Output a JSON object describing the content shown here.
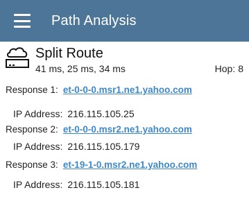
{
  "appbar": {
    "title": "Path Analysis",
    "color": "#4d7597"
  },
  "route": {
    "icon": "cloud-router-icon",
    "title": "Split Route",
    "times": "41 ms,  25 ms,  34 ms",
    "hop_label": "Hop:",
    "hop_value": "8"
  },
  "responses": [
    {
      "label": "Response 1:",
      "host": "et-0-0-0.msr1.ne1.yahoo.com",
      "ip_label": "IP Address:",
      "ip": "216.115.105.25"
    },
    {
      "label": "Response 2:",
      "host": "et-0-0-0.msr2.ne1.yahoo.com",
      "ip_label": "IP Address:",
      "ip": "216.115.105.179"
    },
    {
      "label": "Response 3:",
      "host": "et-19-1-0.msr2.ne1.yahoo.com",
      "ip_label": "IP Address:",
      "ip": "216.115.105.181"
    }
  ],
  "colors": {
    "link": "#3f88c8",
    "text": "#222222"
  }
}
